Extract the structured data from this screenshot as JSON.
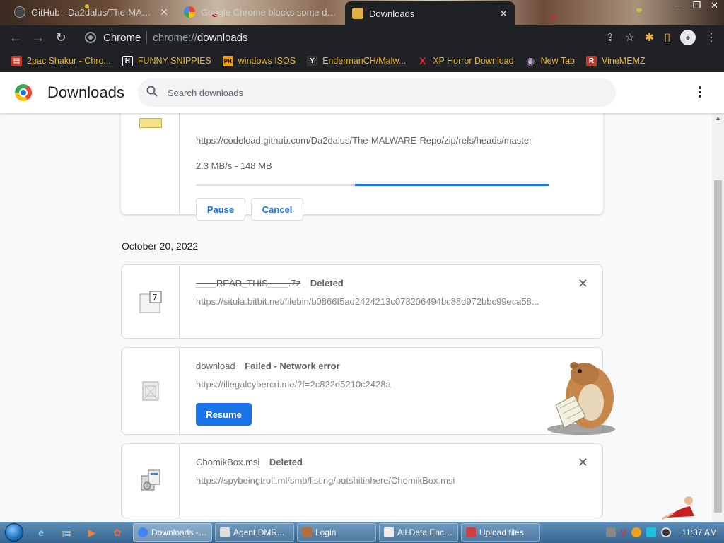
{
  "tabs": [
    {
      "title": "GitHub - Da2dalus/The-MALWA...",
      "favicon_color": "#444444",
      "active": false
    },
    {
      "title": "Google Chrome blocks some do...",
      "favicon_color": "#4285f4",
      "active": false
    },
    {
      "title": "Downloads",
      "favicon_color": "#e0b040",
      "active": true
    }
  ],
  "window_controls": {
    "minimize": "—",
    "restore": "❐",
    "close": "✕"
  },
  "toolbar": {
    "back_icon": "←",
    "forward_icon": "→",
    "reload_icon": "↻",
    "omnibox_label": "Chrome",
    "url_scheme": "chrome://",
    "url_path": "downloads",
    "share_icon": "⇪",
    "star_icon": "☆",
    "extensions_icon": "✱",
    "sidepanel_icon": "▯",
    "menu_icon": "⋮"
  },
  "bookmarks": [
    {
      "label": "2pac Shakur - Chro...",
      "icon_text": "▤",
      "icon_bg": "#c0392b"
    },
    {
      "label": "FUNNY SNIPPIES",
      "icon_text": "H",
      "icon_bg": "#202124"
    },
    {
      "label": "windows ISOS",
      "icon_text": "PH",
      "icon_bg": "#f39c12"
    },
    {
      "label": "EndermanCH/Malw...",
      "icon_text": "Y",
      "icon_bg": "#333333"
    },
    {
      "label": "XP Horror Download",
      "icon_text": "X",
      "icon_bg": "#202124"
    },
    {
      "label": "New Tab",
      "icon_text": "◉",
      "icon_bg": "#7a6e8e"
    },
    {
      "label": "VineMEMZ",
      "icon_text": "R",
      "icon_bg": "#c0392b"
    }
  ],
  "header": {
    "title": "Downloads",
    "search_placeholder": "Search downloads",
    "menu_icon": "⋮"
  },
  "active_download": {
    "url": "https://codeload.github.com/Da2dalus/The-MALWARE-Repo/zip/refs/heads/master",
    "speed": "2.3 MB/s - 148 MB",
    "progress": 0.55,
    "pause_label": "Pause",
    "cancel_label": "Cancel"
  },
  "date_group": "October 20, 2022",
  "items": [
    {
      "filename": "____READ_THIS____.7z",
      "status": "Deleted",
      "url": "https://situla.bitbit.net/filebin/b0866f5ad2424213c078206494bc88d972bbc99eca58...",
      "close": "✕"
    },
    {
      "filename": "download",
      "status": "Failed - Network error",
      "url": "https://illegalcybercri.me/?f=2c822d5210c2428a",
      "resume_label": "Resume"
    },
    {
      "filename": "ChomikBox.msi",
      "status": "Deleted",
      "url": "https://spybeingtroll.ml/smb/listing/putshitinhere/ChomikBox.msi",
      "close": "✕"
    }
  ],
  "taskbar": {
    "buttons": [
      {
        "label": "Downloads - ...",
        "icon_color": "#4285f4",
        "active": true
      },
      {
        "label": "Agent.DMR...",
        "icon_color": "#dddddd",
        "active": false
      },
      {
        "label": "Login",
        "icon_color": "#b07040",
        "active": false
      },
      {
        "label": "All Data Encr...",
        "icon_color": "#eeeeee",
        "active": false
      },
      {
        "label": "Upload files",
        "icon_color": "#d04040",
        "active": false
      }
    ],
    "clock": "11:37 AM"
  }
}
